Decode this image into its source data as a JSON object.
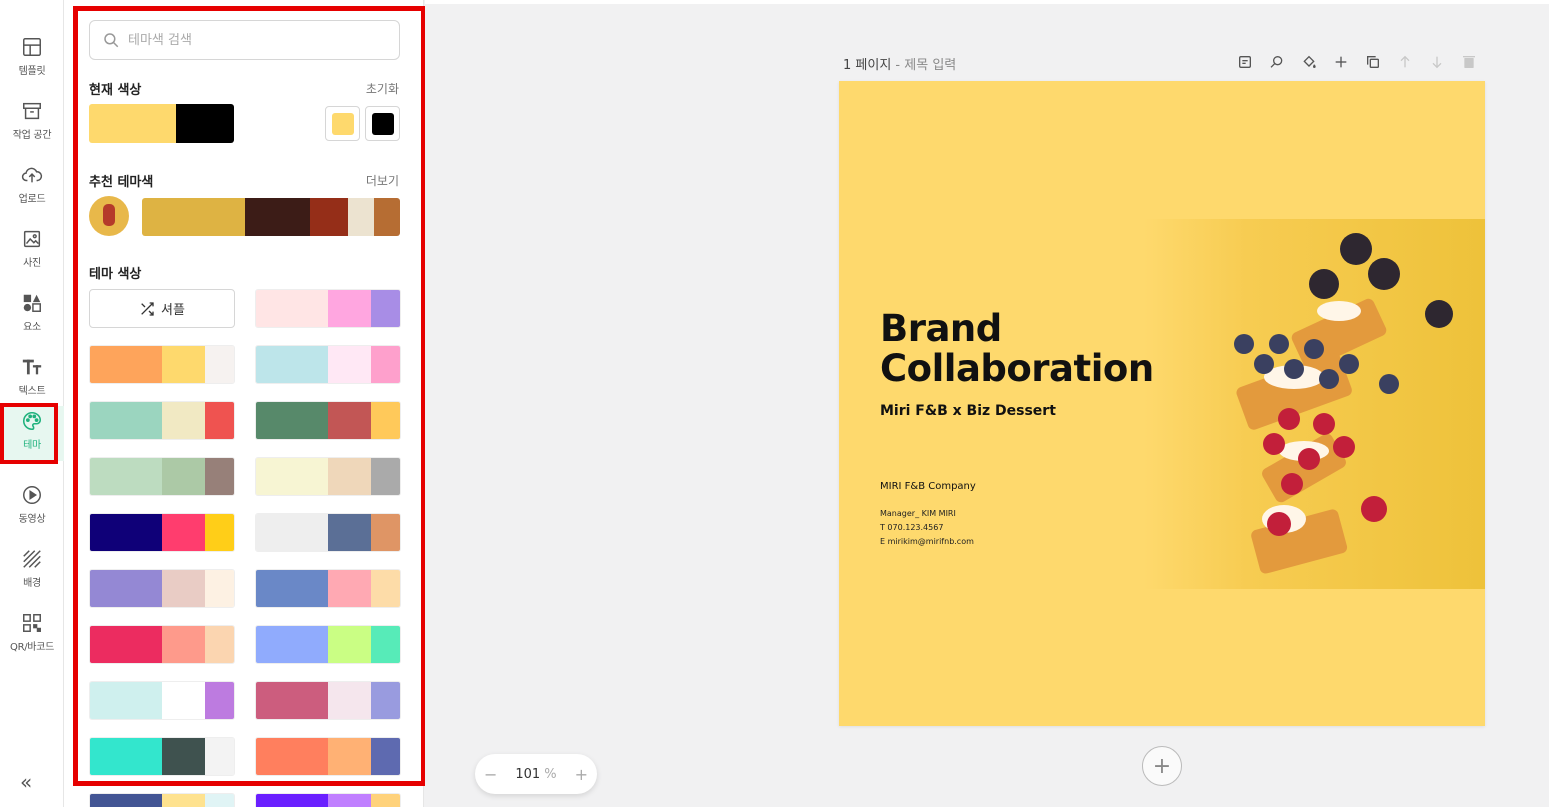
{
  "sidebar": {
    "items": [
      {
        "label": "템플릿",
        "icon": "layout-icon"
      },
      {
        "label": "작업 공간",
        "icon": "archive-icon"
      },
      {
        "label": "업로드",
        "icon": "cloud-upload-icon"
      },
      {
        "label": "사진",
        "icon": "image-icon"
      },
      {
        "label": "요소",
        "icon": "shapes-icon"
      },
      {
        "label": "텍스트",
        "icon": "text-icon"
      },
      {
        "label": "테마",
        "icon": "palette-icon"
      },
      {
        "label": "동영상",
        "icon": "play-icon"
      },
      {
        "label": "배경",
        "icon": "pattern-icon"
      },
      {
        "label": "QR/바코드",
        "icon": "qr-icon"
      }
    ],
    "active": "테마",
    "collapse_glyph": "«"
  },
  "theme_panel": {
    "search_placeholder": "테마색 검색",
    "current_colors": {
      "title": "현재 색상",
      "reset": "초기화",
      "colors": [
        "#fed96d",
        "#000000"
      ]
    },
    "recommended": {
      "title": "추천 테마색",
      "more": "더보기",
      "colors": [
        "#deb343",
        "#3c1c17",
        "#952e18",
        "#ece3d0",
        "#b66d33"
      ]
    },
    "themes": {
      "title": "테마 색상",
      "shuffle_label": "셔플",
      "palettes": [
        [
          "#fea45b",
          "#fed96d",
          "#f6f2f0"
        ],
        [
          "#9bd5bf",
          "#f1e9c3",
          "#ef5350"
        ],
        [
          "#bddcc0",
          "#acc9a6",
          "#978079"
        ],
        [
          "#0f0078",
          "#ff3d6e",
          "#ffce18"
        ],
        [
          "#9488d4",
          "#e9ccc5",
          "#fdf1e3"
        ],
        [
          "#ec2c60",
          "#fe9a8b",
          "#fbd5b0"
        ],
        [
          "#cff0ee",
          "#ffffff",
          "#bd7be0"
        ],
        [
          "#33e6cd",
          "#3f524f",
          "#f3f3f3"
        ],
        [
          "#435594",
          "#fee28f",
          "#e0f4f5"
        ],
        [
          "#ffe5e5",
          "#ffa6e0",
          "#a88de6"
        ],
        [
          "#bde5ea",
          "#ffe8f5",
          "#fea0cc"
        ],
        [
          "#57896a",
          "#c25655",
          "#ffc95a"
        ],
        [
          "#f7f5d3",
          "#efd7ba",
          "#aaaaaa"
        ],
        [
          "#eeeeee",
          "#5b6f96",
          "#df9565"
        ],
        [
          "#6a88c7",
          "#ffa9b3",
          "#fddca8"
        ],
        [
          "#90abfd",
          "#cafe84",
          "#57ebb8"
        ],
        [
          "#cc5d7e",
          "#f5e6ed",
          "#999bdf"
        ],
        [
          "#ff7f5e",
          "#ffb174",
          "#5e6ab0"
        ],
        [
          "#6a1fff",
          "#c07fff",
          "#ffd27b"
        ]
      ]
    }
  },
  "page": {
    "number_label": "1 페이지",
    "separator": " - ",
    "title_placeholder": "제목 입력",
    "tools": [
      "note-icon",
      "magic-icon",
      "fill-icon",
      "plus-icon",
      "duplicate-icon",
      "move-up-icon",
      "move-down-icon",
      "trash-icon"
    ],
    "design": {
      "title_line1": "Brand",
      "title_line2": "Collaboration",
      "subtitle": "Miri F&B  x  Biz Dessert",
      "company": "MIRI F&B Company",
      "manager": "Manager_ KIM MIRI",
      "phone": "T  070.123.4567",
      "email": "E  mirikim@mirifnb.com",
      "background": "#fed96d"
    }
  },
  "zoom": {
    "minus": "−",
    "value": "101",
    "unit": "%",
    "plus": "+"
  },
  "add_page_glyph": "+"
}
